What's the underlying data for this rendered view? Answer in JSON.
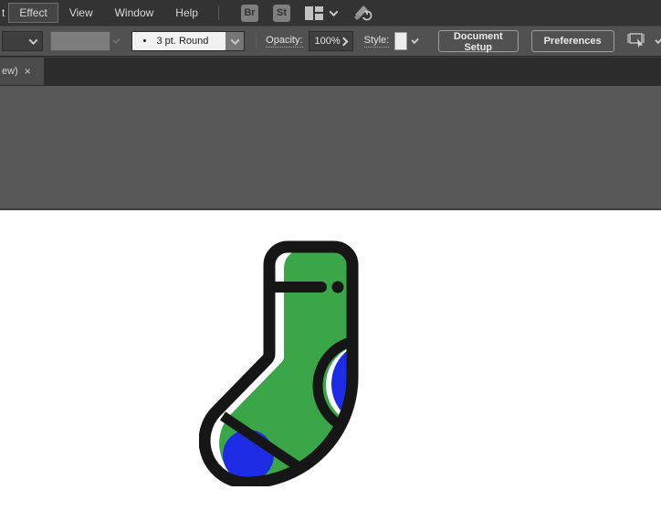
{
  "colors": {
    "sock-green": "#3aa648",
    "sock-blue": "#1d2ce4",
    "sock-outline": "#161616",
    "toolbar-bg": "#515151",
    "menubar-bg": "#333333"
  },
  "menubar": {
    "partial_item": "t",
    "items": [
      {
        "label": "Effect"
      },
      {
        "label": "View"
      },
      {
        "label": "Window"
      },
      {
        "label": "Help"
      }
    ],
    "active_item": "Effect",
    "badges": [
      "Br",
      "St"
    ],
    "icons": [
      "workspace-switcher-icon",
      "chevron-down-icon",
      "gpu-performance-icon"
    ]
  },
  "controlbar": {
    "brush_bullet": "•",
    "brush_value": "3 pt. Round",
    "opacity_label": "Opacity:",
    "opacity_value": "100%",
    "style_label": "Style:",
    "buttons": [
      "Document Setup",
      "Preferences"
    ],
    "icons": [
      "variant-dropdown-icon",
      "stroke-swatch-icon",
      "style-swatch-icon",
      "artboard-tool-icon",
      "chevron-down-icon",
      "chevron-right-icon"
    ]
  },
  "tab": {
    "label": "ew)",
    "close": "×"
  },
  "canvas": {
    "artwork": "green sock with blue heel and toe patches, black outline, cuff line and dot"
  }
}
